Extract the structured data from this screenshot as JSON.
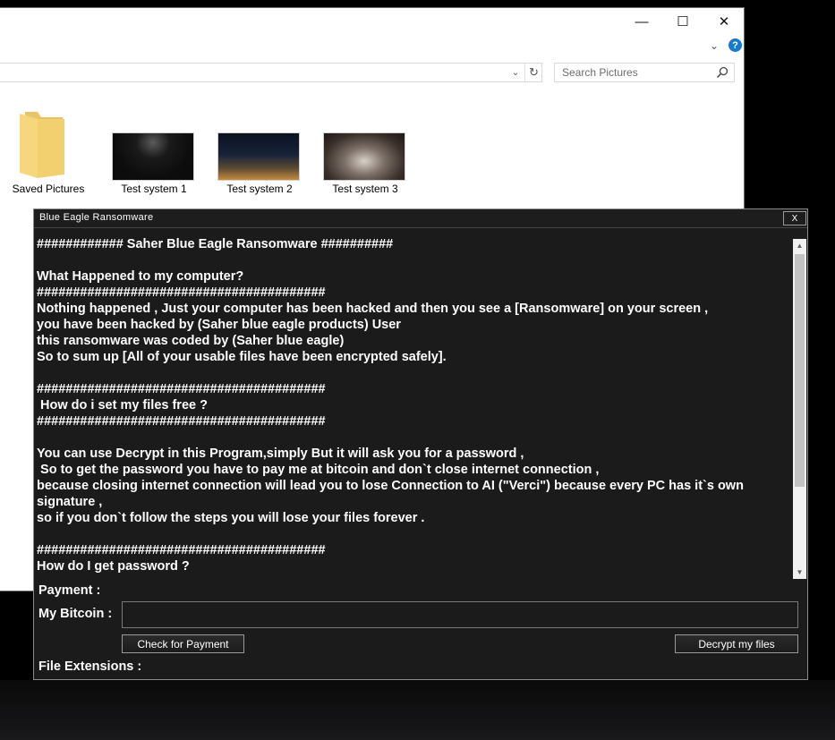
{
  "explorer": {
    "window_controls": {
      "minimize": "—",
      "maximize": "☐",
      "close": "✕"
    },
    "help_label": "?",
    "search": {
      "placeholder": "Search Pictures"
    },
    "items": [
      {
        "label": "Saved Pictures",
        "type": "folder"
      },
      {
        "label": "Test system 1",
        "type": "image"
      },
      {
        "label": "Test system 2",
        "type": "image"
      },
      {
        "label": "Test system 3",
        "type": "image"
      }
    ]
  },
  "ransom": {
    "title": "Blue  Eagle Ransomware",
    "close_label": "X",
    "message_lines": [
      "############ Saher Blue Eagle Ransomware ##########",
      "",
      "What Happened to my computer?",
      "########################################",
      "Nothing happened , Just your computer has been hacked and then you see a [Ransomware] on your screen ,",
      "you have been hacked by (Saher blue eagle products) User",
      "this ransomware was coded by (Saher blue eagle)",
      "So to sum up [All of your usable files have been encrypted safely].",
      "",
      "########################################",
      " How do i set my files free ?",
      "########################################",
      "",
      "You can use Decrypt in this Program,simply But it will ask you for a password ,",
      " So to get the password you have to pay me at bitcoin and don`t close internet connection ,",
      "because closing internet connection will lead you to lose Connection to AI (\"Verci\") because every PC has it`s own signature ,",
      "so if you don`t follow the steps you will lose your files forever .",
      "",
      "########################################",
      "How do I get password ?"
    ],
    "payment_label": "Payment :",
    "bitcoin_label": "My Bitcoin :",
    "bitcoin_value": "",
    "check_button": "Check for Payment",
    "decrypt_button": "Decrypt my files",
    "extensions_label": "File Extensions :"
  }
}
